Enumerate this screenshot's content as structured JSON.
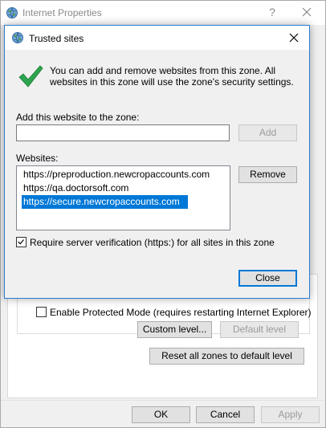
{
  "background_window": {
    "title": "Internet Properties",
    "help_glyph": "?",
    "protected_mode_label": "Enable Protected Mode (requires restarting Internet Explorer)",
    "protected_mode_checked": false,
    "custom_level_label": "Custom level...",
    "default_level_label": "Default level",
    "reset_all_label": "Reset all zones to default level",
    "ok_label": "OK",
    "cancel_label": "Cancel",
    "apply_label": "Apply"
  },
  "dialog": {
    "title": "Trusted sites",
    "intro": "You can add and remove websites from this zone. All websites in this zone will use the zone's security settings.",
    "add_label": "Add this website to the zone:",
    "add_input_value": "",
    "add_button": "Add",
    "websites_label": "Websites:",
    "websites": [
      {
        "url": "https://preproduction.newcropaccounts.com",
        "selected": false
      },
      {
        "url": "https://qa.doctorsoft.com",
        "selected": false
      },
      {
        "url": "https://secure.newcropaccounts.com",
        "selected": true
      }
    ],
    "remove_button": "Remove",
    "require_verification_label": "Require server verification (https:) for all sites in this zone",
    "require_verification_checked": true,
    "close_button": "Close"
  },
  "icons": {
    "window_icon": "internet-globe-icon",
    "dialog_icon": "internet-globe-icon",
    "check_icon": "green-check-icon",
    "close_icon": "close-icon"
  },
  "colors": {
    "accent": "#0078d7",
    "check_green": "#2ea44f",
    "dialog_border": "#2b7cd3"
  }
}
